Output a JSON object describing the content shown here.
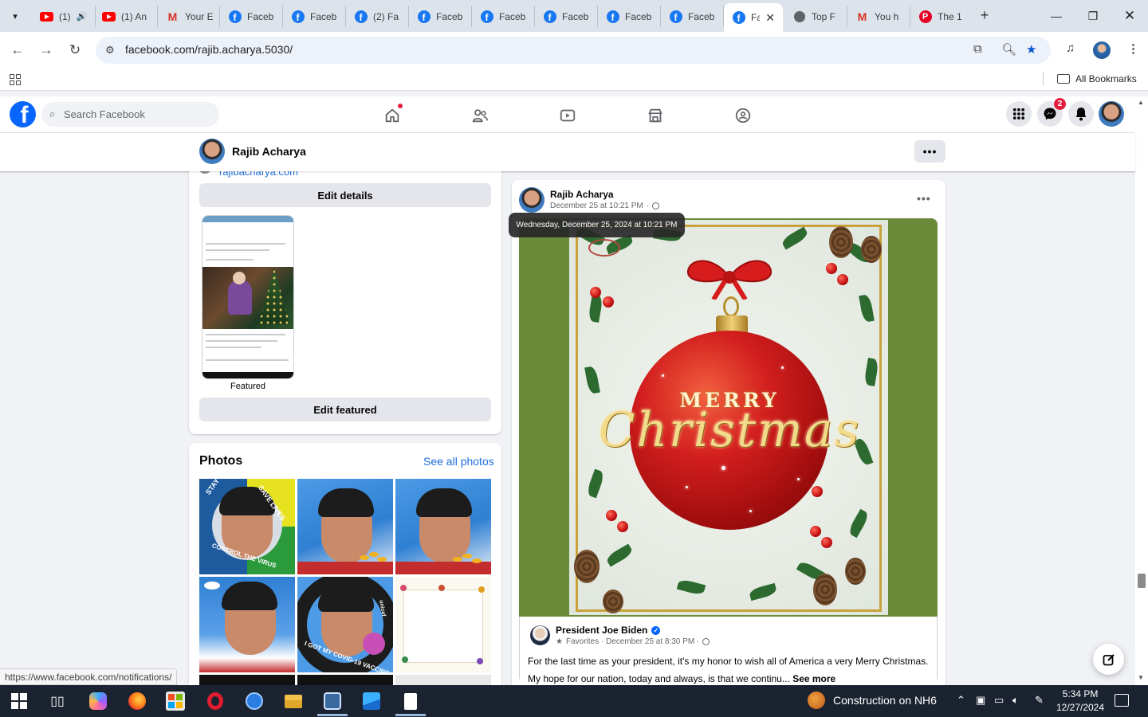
{
  "browser": {
    "tabs": [
      {
        "title": "(1)",
        "icon": "youtube-icon"
      },
      {
        "title": "(1) An",
        "icon": "youtube-icon"
      },
      {
        "title": "Your E",
        "icon": "gmail-icon"
      },
      {
        "title": "Faceb",
        "icon": "facebook-icon"
      },
      {
        "title": "Faceb",
        "icon": "facebook-icon"
      },
      {
        "title": "(2) Fa",
        "icon": "facebook-icon"
      },
      {
        "title": "Faceb",
        "icon": "facebook-icon"
      },
      {
        "title": "Faceb",
        "icon": "facebook-icon"
      },
      {
        "title": "Faceb",
        "icon": "facebook-icon"
      },
      {
        "title": "Faceb",
        "icon": "facebook-icon"
      },
      {
        "title": "Faceb",
        "icon": "facebook-icon"
      },
      {
        "title": "Fa",
        "icon": "facebook-icon",
        "active": true
      },
      {
        "title": "Top F",
        "icon": "globe-icon"
      },
      {
        "title": "You h",
        "icon": "gmail-icon"
      },
      {
        "title": "The 1",
        "icon": "pinterest-icon"
      }
    ],
    "url": "facebook.com/rajib.acharya.5030/",
    "bookmarks_label": "All Bookmarks",
    "status_url": "https://www.facebook.com/notifications/"
  },
  "facebook": {
    "search_placeholder": "Search Facebook",
    "messenger_badge": "2",
    "profile_name": "Rajib Acharya",
    "intro": {
      "website": "rajibacharya.com",
      "edit_details": "Edit details",
      "featured_label": "Featured",
      "edit_featured": "Edit featured"
    },
    "photos": {
      "title": "Photos",
      "see_all": "See all photos",
      "badge_texts": {
        "stay_alert": "STAY ALERT",
        "save_lives": "SAVE LIVES",
        "control_virus": "CONTROL THE VIRUS",
        "vaccine": "I GOT MY COVID-19 VACCINE",
        "unicef": "unicef"
      }
    },
    "post": {
      "author": "Rajib Acharya",
      "date": "December 25 at 10:21 PM",
      "tooltip": "Wednesday, December 25, 2024 at 10:21 PM",
      "image_text_top": "MERRY",
      "image_text_bottom": "Christmas",
      "shared": {
        "author": "President Joe Biden",
        "meta": "Favorites · December 25 at 8:30 PM ·",
        "text": "For the last time as your president, it's my honor to wish all of America a very Merry Christmas. My hope for our nation, today and always, is that we continu...",
        "see_more": "See more"
      }
    }
  },
  "taskbar": {
    "weather": "Construction on NH6",
    "time": "5:34 PM",
    "date": "12/27/2024"
  },
  "colors": {
    "facebook_blue": "#0866ff",
    "link_blue": "#216fdb",
    "taskbar_bg": "#1c2330",
    "ornament_red": "#d21e1e",
    "xmas_green": "#6b8b3a"
  }
}
